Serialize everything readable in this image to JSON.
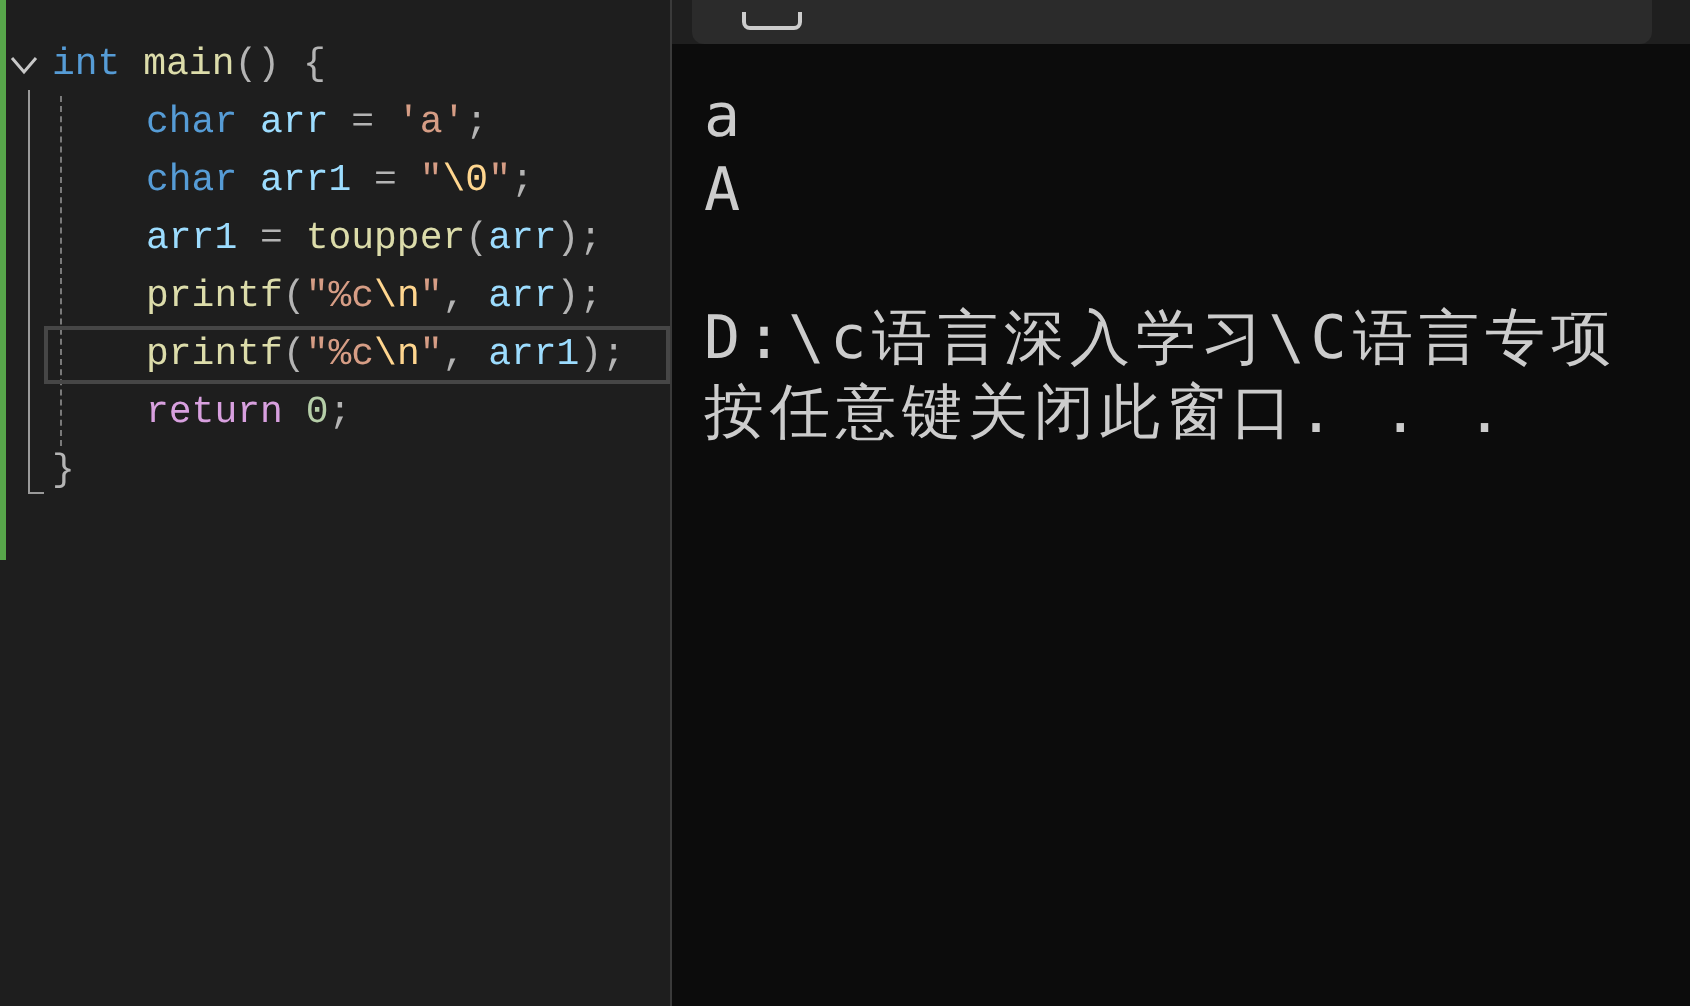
{
  "editor": {
    "fold": {
      "expanded": true
    },
    "lines": [
      {
        "selected": false,
        "tokens": [
          {
            "kind": "type",
            "text": "int"
          },
          {
            "kind": "function",
            "text": " main"
          },
          {
            "kind": "punct",
            "text": "() {"
          }
        ],
        "children": [
          {
            "selected": false,
            "tokens": [
              {
                "kind": "type",
                "text": "char"
              },
              {
                "kind": "ident",
                "text": " arr"
              },
              {
                "kind": "punct",
                "text": " = "
              },
              {
                "kind": "string",
                "text": "'a'"
              },
              {
                "kind": "punct",
                "text": ";"
              }
            ]
          },
          {
            "selected": false,
            "tokens": [
              {
                "kind": "type",
                "text": "char"
              },
              {
                "kind": "ident",
                "text": " arr1"
              },
              {
                "kind": "punct",
                "text": " = "
              },
              {
                "kind": "string",
                "text": "\""
              },
              {
                "kind": "escape",
                "text": "\\0"
              },
              {
                "kind": "string",
                "text": "\""
              },
              {
                "kind": "punct",
                "text": ";"
              }
            ]
          },
          {
            "selected": false,
            "tokens": [
              {
                "kind": "ident",
                "text": "arr1"
              },
              {
                "kind": "punct",
                "text": " = "
              },
              {
                "kind": "function",
                "text": "toupper"
              },
              {
                "kind": "punct",
                "text": "("
              },
              {
                "kind": "ident",
                "text": "arr"
              },
              {
                "kind": "punct",
                "text": ");"
              }
            ]
          },
          {
            "selected": false,
            "tokens": [
              {
                "kind": "function",
                "text": "printf"
              },
              {
                "kind": "punct",
                "text": "("
              },
              {
                "kind": "string",
                "text": "\"%c"
              },
              {
                "kind": "escape",
                "text": "\\n"
              },
              {
                "kind": "string",
                "text": "\""
              },
              {
                "kind": "punct",
                "text": ", "
              },
              {
                "kind": "ident",
                "text": "arr"
              },
              {
                "kind": "punct",
                "text": ");"
              }
            ]
          },
          {
            "selected": true,
            "tokens": [
              {
                "kind": "function",
                "text": "printf"
              },
              {
                "kind": "punct",
                "text": "("
              },
              {
                "kind": "string",
                "text": "\"%c"
              },
              {
                "kind": "escape",
                "text": "\\n"
              },
              {
                "kind": "string",
                "text": "\""
              },
              {
                "kind": "punct",
                "text": ", "
              },
              {
                "kind": "ident",
                "text": "arr1"
              },
              {
                "kind": "punct",
                "text": ");"
              }
            ]
          },
          {
            "selected": false,
            "tokens": [
              {
                "kind": "control",
                "text": "return"
              },
              {
                "kind": "number",
                "text": " 0"
              },
              {
                "kind": "punct",
                "text": ";"
              }
            ]
          }
        ]
      },
      {
        "selected": false,
        "tokens": [
          {
            "kind": "punct",
            "text": "}"
          }
        ]
      }
    ]
  },
  "terminal": {
    "blocks": [
      {
        "lines": [
          "a",
          "A"
        ]
      },
      {
        "lines": [
          "D:\\c语言深入学习\\C语言专项",
          "按任意键关闭此窗口. . ."
        ]
      }
    ]
  }
}
